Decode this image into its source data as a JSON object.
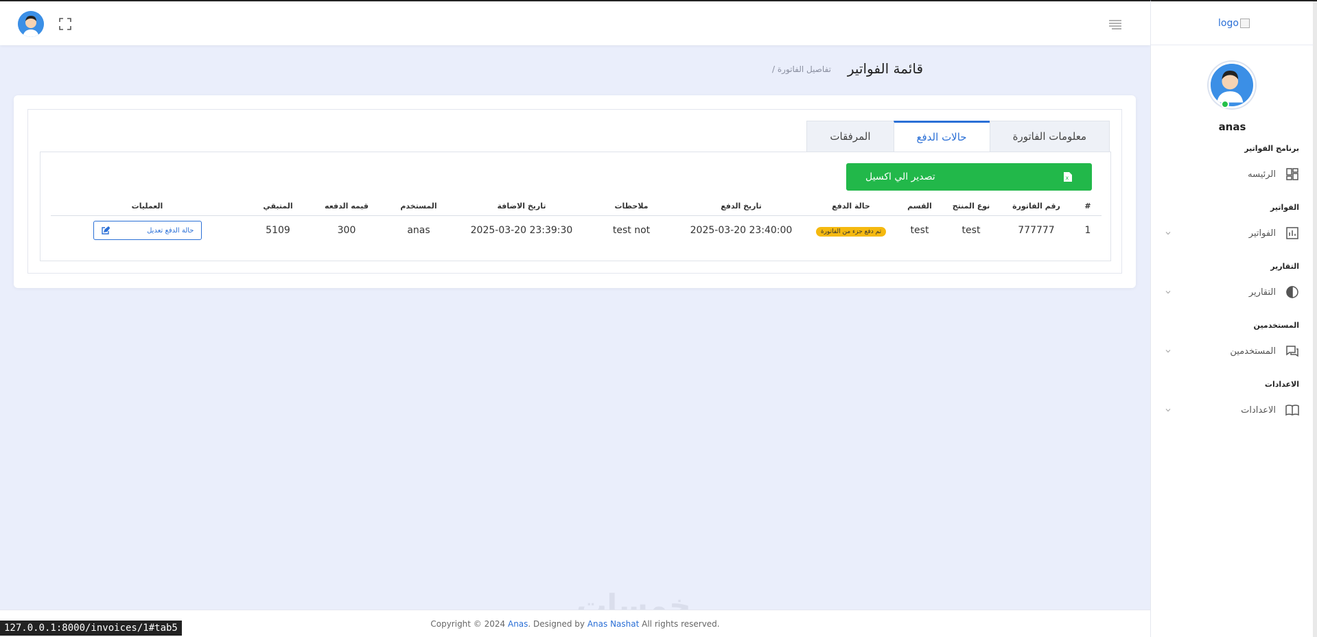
{
  "topbar": {
    "avatar": "avatar",
    "fullscreen_icon": "fullscreen-icon",
    "menu_icon": "hamburger-menu-icon"
  },
  "sidebar": {
    "logo_text": "logo",
    "user_name": "anas",
    "sections": [
      {
        "heading": "برنامج الفواتير",
        "item": "الرئيسه",
        "icon": "dashboard-icon",
        "has_chevron": false
      },
      {
        "heading": "الفواتير",
        "item": "الفواتير",
        "icon": "chart-icon",
        "has_chevron": true
      },
      {
        "heading": "التقارير",
        "item": "التقارير",
        "icon": "pie-icon",
        "has_chevron": true
      },
      {
        "heading": "المستخدمين",
        "item": "المستخدمين",
        "icon": "chat-icon",
        "has_chevron": true
      },
      {
        "heading": "الاعدادات",
        "item": "الاعدادات",
        "icon": "book-icon",
        "has_chevron": true
      }
    ]
  },
  "header": {
    "title": "قائمة الفواتير",
    "breadcrumb": "/ تفاصيل الفاتورة"
  },
  "tabs": [
    {
      "label": "معلومات الفاتورة",
      "active": false
    },
    {
      "label": "حالات الدفع",
      "active": true
    },
    {
      "label": "المرفقات",
      "active": false
    }
  ],
  "export_button": {
    "label": "تصدير الي اكسيل",
    "icon": "excel-icon"
  },
  "table": {
    "headers": [
      "#",
      "رقم الفاتورة",
      "نوع المنتج",
      "القسم",
      "حالة الدفع",
      "تاريخ الدفع",
      "ملاحظات",
      "تاريخ الاضافة",
      "المستخدم",
      "قيمه الدفعه",
      "المتبقي",
      "العمليات"
    ],
    "rows": [
      {
        "index": "1",
        "invoice_number": "777777",
        "product": "test",
        "section": "test",
        "status": "تم دفع جزء من الفاتورة",
        "payment_date": "2025-03-20 23:40:00",
        "notes": "test not",
        "created_at": "2025-03-20 23:39:30",
        "user": "anas",
        "amount": "300",
        "remaining": "5109",
        "action_label": "حالة الدفع تعديل"
      }
    ]
  },
  "colors": {
    "accent": "#2a6fd6",
    "success": "#22b84a",
    "warning": "#f5b90f",
    "background": "#eaeefb"
  },
  "footer": {
    "prefix": "Copyright © 2024 ",
    "brand": "Anas",
    "middle": ". Designed by ",
    "designer": "Anas Nashat",
    "suffix": " All rights reserved."
  },
  "watermark": "خمسات",
  "status_url": "127.0.0.1:8000/invoices/1#tab5"
}
